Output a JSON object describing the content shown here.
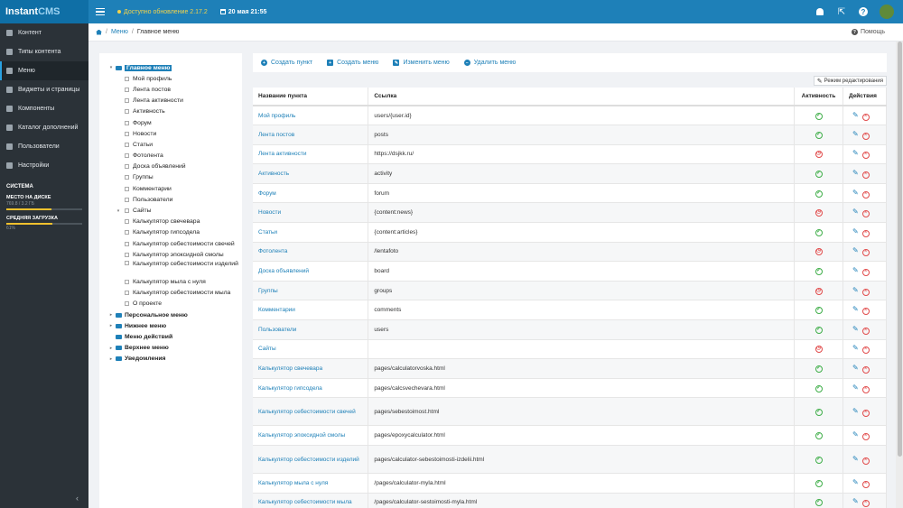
{
  "topbar": {
    "logo_main": "Instant",
    "logo_cms": "CMS",
    "update_text": "Доступно обновление 2.17.2",
    "date_text": "20 мая 21:55"
  },
  "sidebar": {
    "items": [
      {
        "label": "Контент",
        "icon": "content-icon"
      },
      {
        "label": "Типы контента",
        "icon": "wrench-icon"
      },
      {
        "label": "Меню",
        "icon": "menu-icon"
      },
      {
        "label": "Виджеты и страницы",
        "icon": "widgets-icon"
      },
      {
        "label": "Компоненты",
        "icon": "puzzle-icon"
      },
      {
        "label": "Каталог дополнений",
        "icon": "cart-icon"
      },
      {
        "label": "Пользователи",
        "icon": "users-icon"
      },
      {
        "label": "Настройки",
        "icon": "gear-icon"
      }
    ],
    "active_index": 2,
    "system_title": "СИСТЕМА",
    "disk_label": "МЕСТО НА ДИСКЕ",
    "disk_sub": "769.8 / 3.2 ГБ",
    "disk_fraction": 0.6,
    "load_label": "СРЕДНЯЯ ЗАГРУЗКА",
    "load_sub": "61%",
    "load_fraction": 0.61
  },
  "breadcrumb": {
    "menu": "Меню",
    "current": "Главное меню",
    "help": "Помощь"
  },
  "tree": [
    {
      "label": "Главное меню",
      "level": 0,
      "type": "folder",
      "bold": true,
      "selected": true,
      "arrow": "▾"
    },
    {
      "label": "Мой профиль",
      "level": 1,
      "type": "leaf"
    },
    {
      "label": "Лента постов",
      "level": 1,
      "type": "leaf"
    },
    {
      "label": "Лента активности",
      "level": 1,
      "type": "leaf"
    },
    {
      "label": "Активность",
      "level": 1,
      "type": "leaf"
    },
    {
      "label": "Форум",
      "level": 1,
      "type": "leaf"
    },
    {
      "label": "Новости",
      "level": 1,
      "type": "leaf"
    },
    {
      "label": "Статьи",
      "level": 1,
      "type": "leaf"
    },
    {
      "label": "Фотолента",
      "level": 1,
      "type": "leaf"
    },
    {
      "label": "Доска объявлений",
      "level": 1,
      "type": "leaf"
    },
    {
      "label": "Группы",
      "level": 1,
      "type": "leaf"
    },
    {
      "label": "Комментарии",
      "level": 1,
      "type": "leaf"
    },
    {
      "label": "Пользователи",
      "level": 1,
      "type": "leaf"
    },
    {
      "label": "Сайты",
      "level": 1,
      "type": "leaf",
      "arrow": "▾"
    },
    {
      "label": "Калькулятор свечевара",
      "level": 1,
      "type": "leaf"
    },
    {
      "label": "Калькулятор гипсодела",
      "level": 1,
      "type": "leaf"
    },
    {
      "label": "Калькулятор себестоимости свечей",
      "level": 1,
      "type": "leaf"
    },
    {
      "label": "Калькулятор эпоксидной смолы",
      "level": 1,
      "type": "leaf"
    },
    {
      "label": "Калькулятор себестоимости изделий",
      "level": 1,
      "type": "leaf",
      "tall": true
    },
    {
      "label": "Калькулятор мыла с нуля",
      "level": 1,
      "type": "leaf"
    },
    {
      "label": "Калькулятор себестоимости мыла",
      "level": 1,
      "type": "leaf"
    },
    {
      "label": "О проекте",
      "level": 1,
      "type": "leaf"
    },
    {
      "label": "Персональное меню",
      "level": 0,
      "type": "folder",
      "bold": true,
      "arrow": "▸"
    },
    {
      "label": "Нижнее меню",
      "level": 0,
      "type": "folder",
      "bold": true,
      "arrow": "▸"
    },
    {
      "label": "Меню действий",
      "level": 0,
      "type": "folder",
      "bold": true
    },
    {
      "label": "Верхнее меню",
      "level": 0,
      "type": "folder",
      "bold": true,
      "arrow": "▸"
    },
    {
      "label": "Уведомления",
      "level": 0,
      "type": "folder",
      "bold": true,
      "arrow": "▸"
    }
  ],
  "toolbar": {
    "create_item": "Создать пункт",
    "create_menu": "Создать меню",
    "edit_menu": "Изменить меню",
    "delete_menu": "Удалить меню",
    "edit_mode": "Режим редактирования"
  },
  "table": {
    "headers": {
      "name": "Название пункта",
      "link": "Ссылка",
      "active": "Активность",
      "actions": "Действия"
    },
    "rows": [
      {
        "name": "Мой профиль",
        "link": "users/{user.id}",
        "active": true
      },
      {
        "name": "Лента постов",
        "link": "posts",
        "active": true
      },
      {
        "name": "Лента активности",
        "link": "https://dsjkk.ru/",
        "active": false
      },
      {
        "name": "Активность",
        "link": "activity",
        "active": true
      },
      {
        "name": "Форум",
        "link": "forum",
        "active": true
      },
      {
        "name": "Новости",
        "link": "{content:news}",
        "active": false
      },
      {
        "name": "Статьи",
        "link": "{content:articles}",
        "active": true
      },
      {
        "name": "Фотолента",
        "link": "/lentafoto",
        "active": false
      },
      {
        "name": "Доска объявлений",
        "link": "board",
        "active": true
      },
      {
        "name": "Группы",
        "link": "groups",
        "active": false
      },
      {
        "name": "Комментарии",
        "link": "comments",
        "active": true
      },
      {
        "name": "Пользователи",
        "link": "users",
        "active": true
      },
      {
        "name": "Сайты",
        "link": "",
        "active": false
      },
      {
        "name": "Калькулятор свечевара",
        "link": "pages/calculatorvoska.html",
        "active": true
      },
      {
        "name": "Калькулятор гипсодела",
        "link": "pages/calcsvechevara.html",
        "active": true
      },
      {
        "name": "Калькулятор себестоимости свечей",
        "link": "pages/sebestoimost.html",
        "active": true,
        "tall": true
      },
      {
        "name": "Калькулятор эпоксидной смолы",
        "link": "pages/epoxycalculator.html",
        "active": true
      },
      {
        "name": "Калькулятор себестоимости изделий",
        "link": "pages/calculator-sebestoimosti-izdelii.html",
        "active": true,
        "tall": true
      },
      {
        "name": "Калькулятор мыла с нуля",
        "link": "/pages/calculator-myla.html",
        "active": true
      },
      {
        "name": "Калькулятор себестоимости мыла",
        "link": "/pages/calculator-sestoimosti-myla.html",
        "active": true
      }
    ]
  }
}
